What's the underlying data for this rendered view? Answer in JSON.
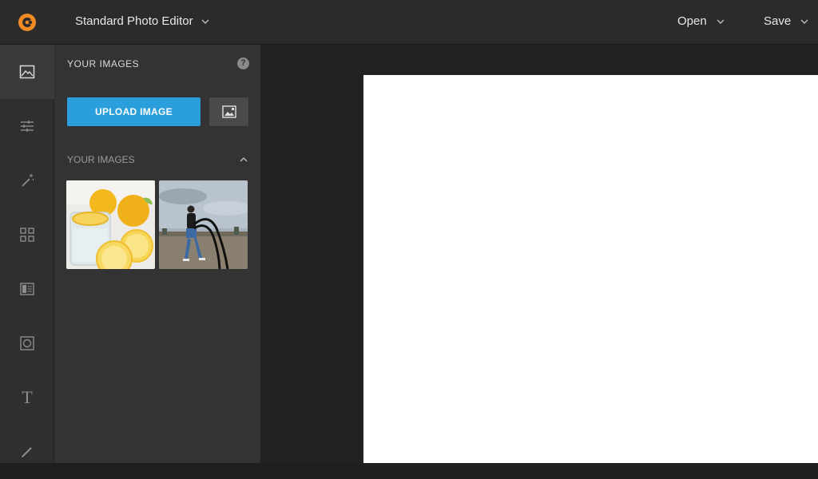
{
  "header": {
    "editor_label": "Standard Photo Editor",
    "open_label": "Open",
    "save_label": "Save"
  },
  "colors": {
    "accent": "#2b9fdb",
    "logo": "#f08a24"
  },
  "rail": {
    "items": [
      {
        "icon": "image-icon",
        "active": true
      },
      {
        "icon": "sliders-icon"
      },
      {
        "icon": "magic-wand-icon"
      },
      {
        "icon": "grid-icon"
      },
      {
        "icon": "frame-icon"
      },
      {
        "icon": "vignette-icon"
      },
      {
        "icon": "text-icon",
        "glyph": "T"
      },
      {
        "icon": "brush-icon"
      }
    ]
  },
  "panel": {
    "title": "YOUR IMAGES",
    "help_glyph": "?",
    "upload_label": "UPLOAD IMAGE",
    "section_title": "YOUR IMAGES",
    "thumbnails": [
      {
        "icon": "lemon-water-photo"
      },
      {
        "icon": "battle-ropes-photo"
      }
    ]
  }
}
